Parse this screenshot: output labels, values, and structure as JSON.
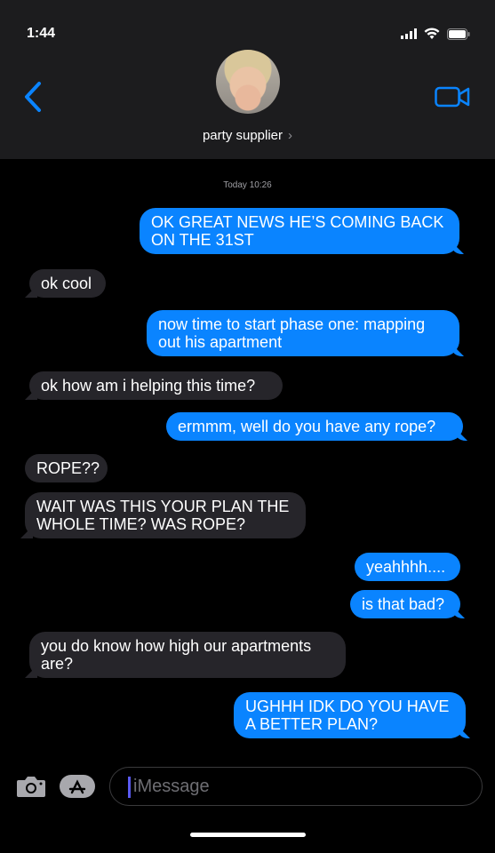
{
  "status": {
    "time": "1:44"
  },
  "contact": {
    "name": "party supplier",
    "chevron": "›"
  },
  "thread": {
    "timestamp": "Today 10:26",
    "messages": [
      {
        "from": "me",
        "text": "OK GREAT NEWS HE’S COMING BACK ON THE 31ST"
      },
      {
        "from": "them",
        "text": "ok cool"
      },
      {
        "from": "me",
        "text": "now time to start phase one: mapping out his apartment"
      },
      {
        "from": "them",
        "text": "ok how am i helping this time?"
      },
      {
        "from": "me",
        "text": "ermmm, well do you have any rope?"
      },
      {
        "from": "them",
        "text": "ROPE??"
      },
      {
        "from": "them",
        "text": "WAIT WAS THIS YOUR PLAN THE WHOLE TIME? WAS ROPE?"
      },
      {
        "from": "me",
        "text": "yeahhhh...."
      },
      {
        "from": "me",
        "text": "is that bad?"
      },
      {
        "from": "them",
        "text": "you do know how high our apartments are?"
      },
      {
        "from": "me",
        "text": "UGHHH IDK DO YOU HAVE A BETTER PLAN?"
      }
    ]
  },
  "input": {
    "placeholder": "iMessage"
  },
  "colors": {
    "sent_bubble": "#0a84ff",
    "received_bubble": "#26252a",
    "accent": "#0a84ff"
  },
  "icons": [
    "back-chevron-icon",
    "video-call-icon",
    "camera-icon",
    "app-store-icon",
    "signal-icon",
    "wifi-icon",
    "battery-icon"
  ]
}
